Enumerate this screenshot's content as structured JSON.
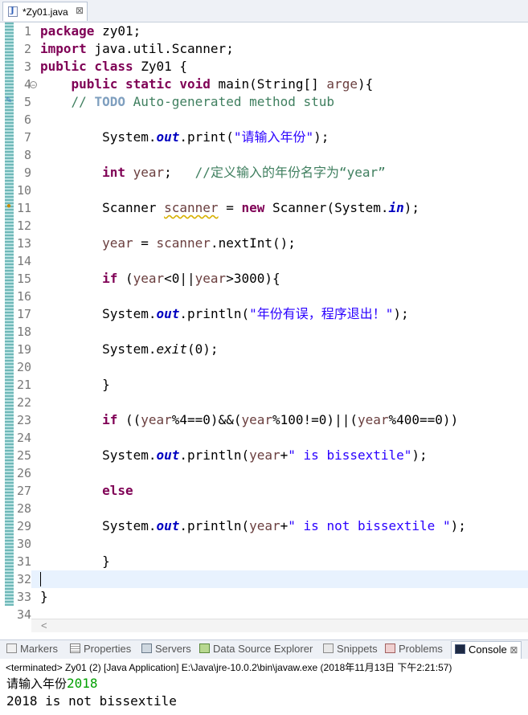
{
  "editor_tab": {
    "title": "*Zy01.java",
    "close": "⊠"
  },
  "line_numbers": [
    "1",
    "2",
    "3",
    "4",
    "5",
    "6",
    "7",
    "8",
    "9",
    "10",
    "11",
    "12",
    "13",
    "14",
    "15",
    "16",
    "17",
    "18",
    "19",
    "20",
    "21",
    "22",
    "23",
    "24",
    "25",
    "26",
    "27",
    "28",
    "29",
    "30",
    "31",
    "32",
    "33",
    "34"
  ],
  "code": {
    "l1": {
      "kw": "package",
      "rest": " zy01;"
    },
    "l2": {
      "kw": "import",
      "rest": " java.util.Scanner;"
    },
    "l3": {
      "kw": "public class",
      "rest": " Zy01 {"
    },
    "l4": {
      "indent": "    ",
      "kw": "public static void",
      "rest": " main(String[] ",
      "var": "arge",
      "end": "){"
    },
    "l5": {
      "indent": "    ",
      "c1": "// ",
      "todo": "TODO",
      "c2": " Auto-generated method stub"
    },
    "l7": {
      "indent": "        ",
      "p1": "System.",
      "fld": "out",
      "p2": ".print(",
      "str": "\"请输入年份\"",
      "end": ");"
    },
    "l9": {
      "indent": "        ",
      "kw": "int",
      "p1": " ",
      "var": "year",
      "p2": ";   ",
      "cm": "//定义输入的年份名字为“year”"
    },
    "l11": {
      "indent": "        ",
      "p1": "Scanner ",
      "var": "scanner",
      "p2": " = ",
      "kw": "new",
      "p3": " Scanner(System.",
      "fld": "in",
      "end": ");"
    },
    "l13": {
      "indent": "        ",
      "var": "year",
      "p1": " = ",
      "var2": "scanner",
      "p2": ".nextInt();"
    },
    "l15": {
      "indent": "        ",
      "kw": "if",
      "p1": " (",
      "v1": "year",
      "p2": "<0||",
      "v2": "year",
      "p3": ">3000){"
    },
    "l17": {
      "indent": "        ",
      "p1": "System.",
      "fld": "out",
      "p2": ".println(",
      "str": "\"年份有误，程序退出！\"",
      "end": ");"
    },
    "l19": {
      "indent": "        ",
      "p1": "System.",
      "st": "exit",
      "p2": "(0);"
    },
    "l21": {
      "indent": "        ",
      "p1": "}"
    },
    "l23": {
      "indent": "        ",
      "kw": "if",
      "p1": " ((",
      "v1": "year",
      "p2": "%4==0)&&(",
      "v2": "year",
      "p3": "%100!=0)||(",
      "v3": "year",
      "p4": "%400==0))"
    },
    "l25": {
      "indent": "        ",
      "p1": "System.",
      "fld": "out",
      "p2": ".println(",
      "var": "year",
      "p3": "+",
      "str": "\" is bissextile\"",
      "end": ");"
    },
    "l27": {
      "indent": "        ",
      "kw": "else"
    },
    "l29": {
      "indent": "        ",
      "p1": "System.",
      "fld": "out",
      "p2": ".println(",
      "var": "year",
      "p3": "+",
      "str": "\" is not bissextile \"",
      "end": ");"
    },
    "l31": {
      "indent": "        ",
      "p1": "}"
    },
    "l33": {
      "p1": "}"
    }
  },
  "views": [
    {
      "label": "Markers"
    },
    {
      "label": "Properties"
    },
    {
      "label": "Servers"
    },
    {
      "label": "Data Source Explorer"
    },
    {
      "label": "Snippets"
    },
    {
      "label": "Problems"
    },
    {
      "label": "Console",
      "close": "⊠"
    }
  ],
  "console": {
    "status": "<terminated> Zy01 (2) [Java Application] E:\\Java\\jre-10.0.2\\bin\\javaw.exe (2018年11月13日 下午2:21:57)",
    "line1_prompt": "请输入年份",
    "line1_input": "2018",
    "line2": "2018 is not bissextile"
  },
  "colors": {
    "keyword": "#7f0055",
    "comment": "#3f7f5f",
    "string": "#2a00ff",
    "field": "#0000c0",
    "input": "#00a000"
  }
}
